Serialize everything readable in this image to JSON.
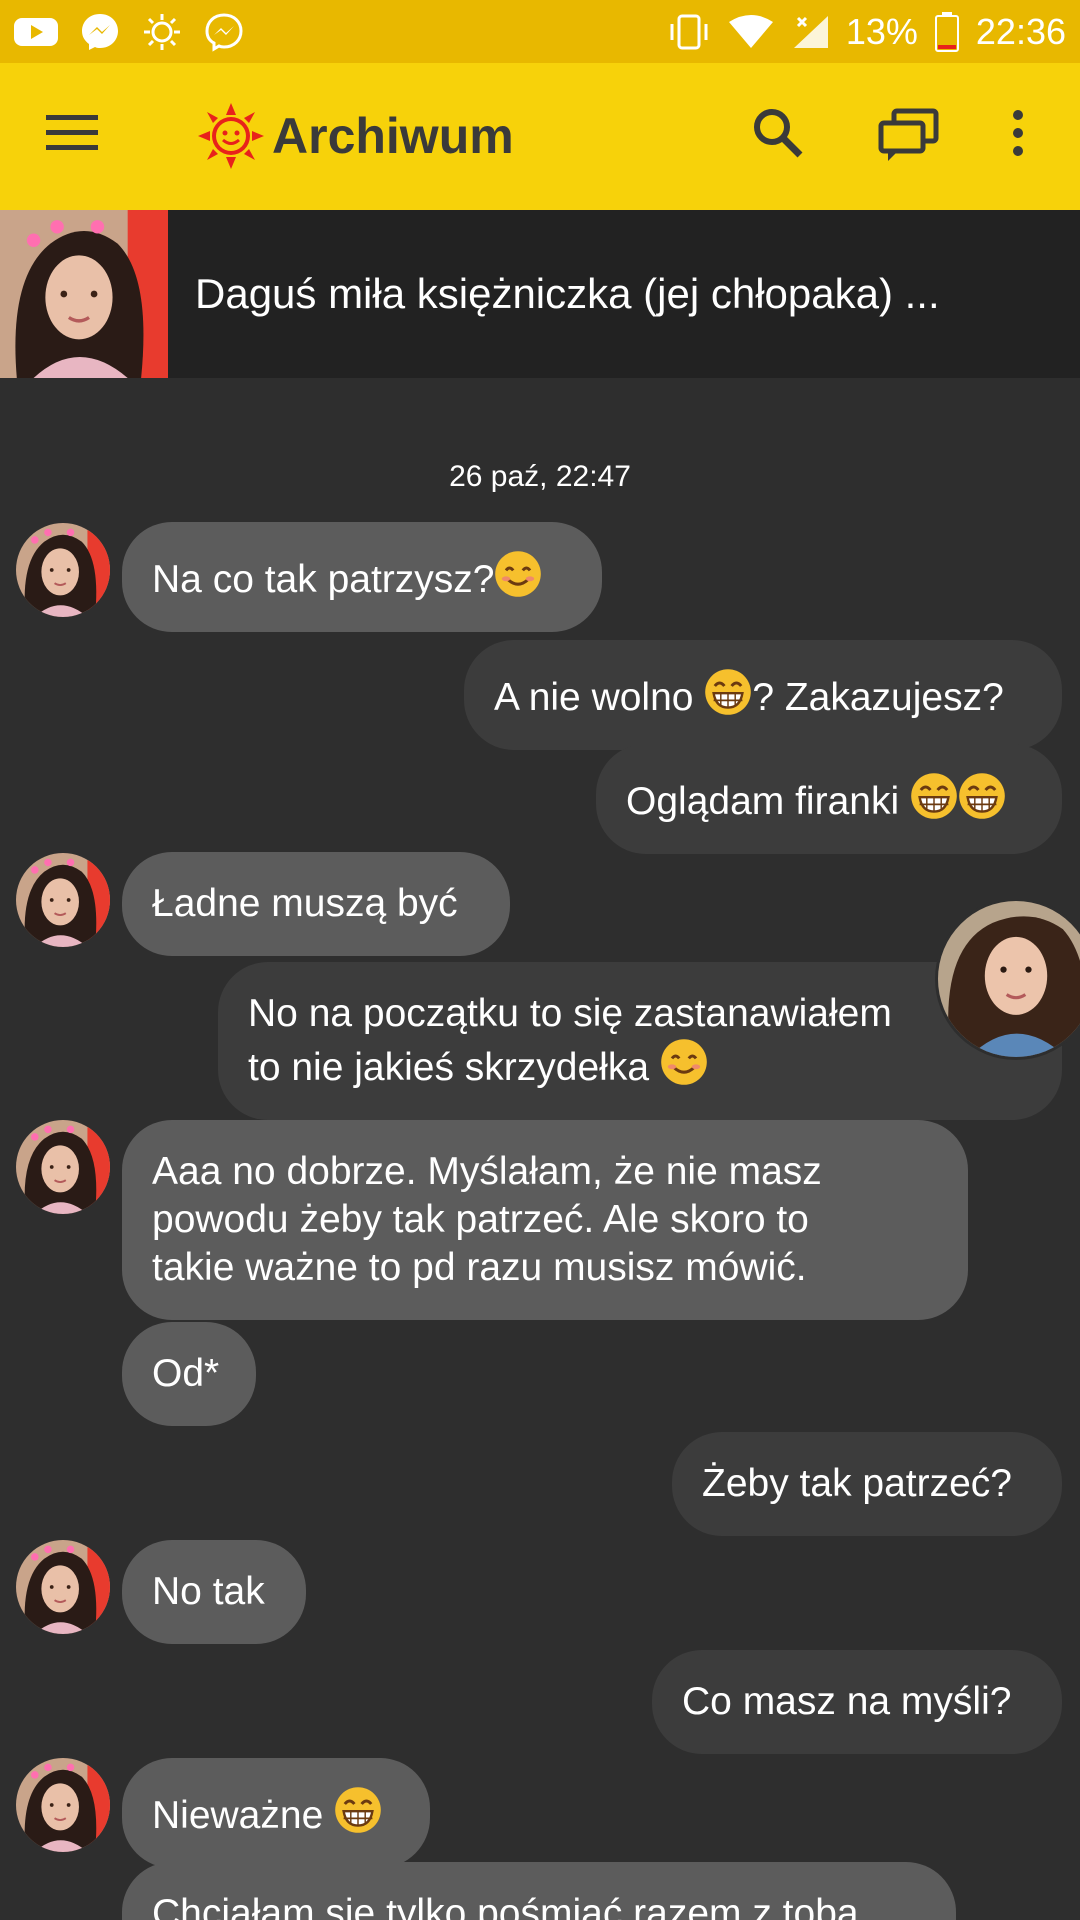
{
  "status_bar": {
    "battery": "13%",
    "time": "22:36",
    "icons": [
      "youtube-icon",
      "messenger-icon",
      "sun-icon",
      "messenger-outline-icon",
      "vibrate-icon",
      "wifi-icon",
      "signal-icon",
      "battery-icon"
    ]
  },
  "app_bar": {
    "title": "Archiwum",
    "icons": [
      "menu-icon",
      "sun-logo-icon",
      "search-icon",
      "chats-icon",
      "more-icon"
    ]
  },
  "conversation": {
    "name": "Daguś miła księżniczka (jej chłopaka) ..."
  },
  "messages": {
    "timestamp": "26 paź, 22:47",
    "m1": "Na co tak patrzysz?",
    "m2": "A nie wolno",
    "m2b": "? Zakazujesz?",
    "m3": "Oglądam firanki",
    "m4": "Ładne muszą być",
    "m5a": "No na początku to się zastanawiałem",
    "m5b": "to nie jakieś skrzydełka",
    "m6a": "Aaa no dobrze. Myślałam,  że nie masz",
    "m6b": "powodu żeby tak patrzeć.  Ale skoro to",
    "m6c": "takie ważne to pd razu musisz mówić.",
    "m7": "Od*",
    "m8": "Żeby tak patrzeć?",
    "m9": "No tak",
    "m10": "Co masz na myśli?",
    "m11": "Nieważne",
    "m12": "Chciałam się tylko pośmiać  razem z tobą"
  },
  "colors": {
    "status_bar": "#e8b800",
    "app_bar": "#f7d20a",
    "background": "#2e2e2e",
    "incoming_bubble": "#5c5c5c",
    "outgoing_bubble": "#3c3c3c",
    "logo": "#e8221b"
  }
}
